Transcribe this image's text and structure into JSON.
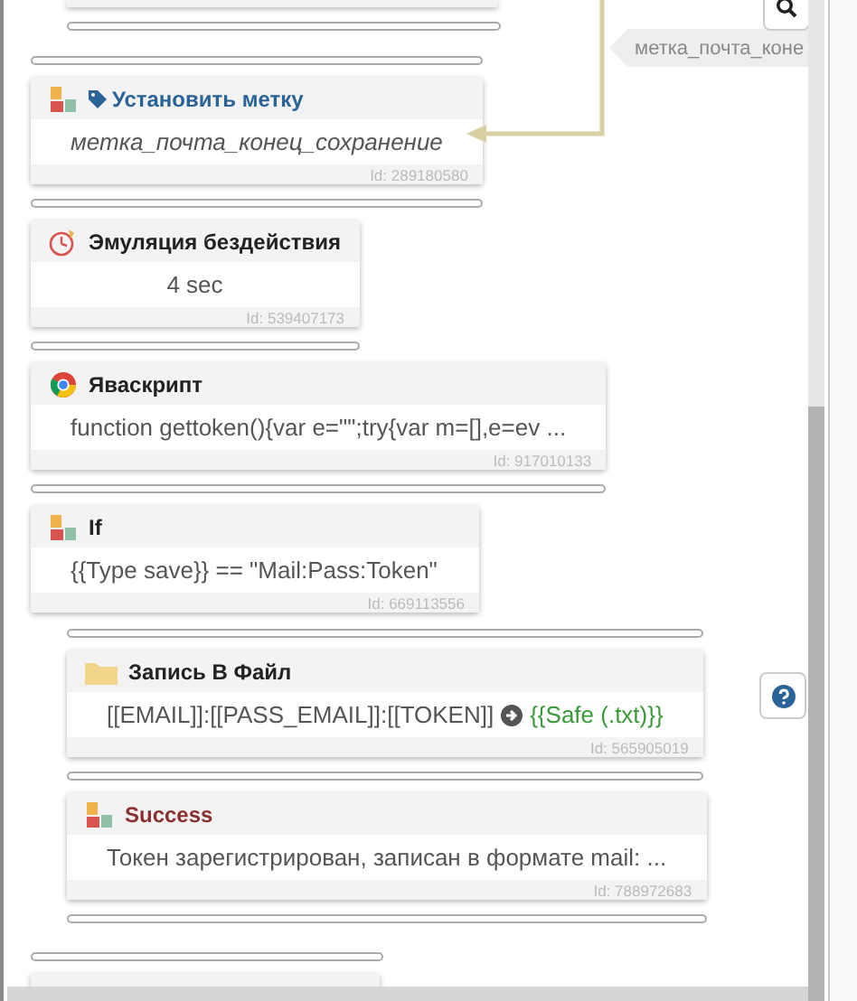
{
  "connector_label": "метка_почта_коне",
  "blocks": [
    {
      "kind": "label",
      "title": "Установить метку",
      "body": "метка_почта_конец_сохранение",
      "id": "Id: 289180580"
    },
    {
      "kind": "delay",
      "title": "Эмуляция бездействия",
      "body": "4 sec",
      "id": "Id: 539407173"
    },
    {
      "kind": "javascript",
      "title": "Яваскрипт",
      "body": "function gettoken(){var e=\"\";try{var m=[],e=ev ...",
      "id": "Id: 917010133"
    },
    {
      "kind": "if",
      "title": "If",
      "body": "{{Type save}} == \"Mail:Pass:Token\"",
      "id": "Id: 669113556",
      "children": [
        {
          "kind": "file",
          "title": "Запись В Файл",
          "body": "[[EMAIL]]:[[PASS_EMAIL]]:[[TOKEN]]",
          "target": "{{Safe (.txt)}}",
          "id": "Id: 565905019"
        },
        {
          "kind": "success",
          "title": "Success",
          "body": "Токен зарегистрирован, записан в формате mail: ...",
          "id": "Id: 788972683"
        }
      ]
    }
  ]
}
